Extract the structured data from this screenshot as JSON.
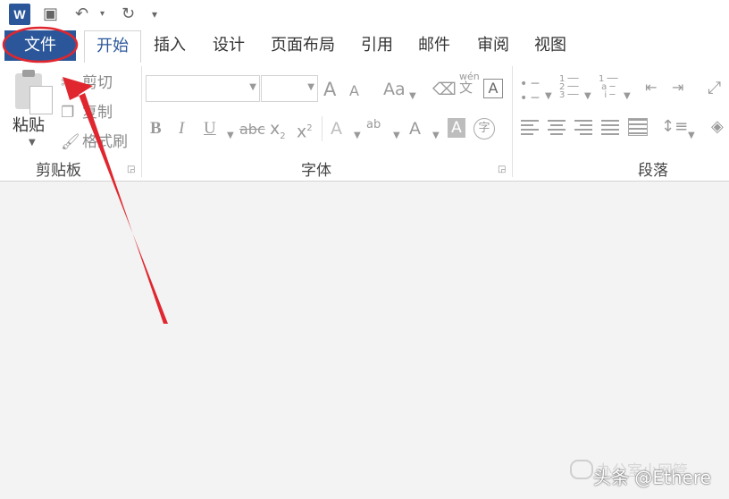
{
  "app": {
    "logo_letter": "W"
  },
  "quick_access": [
    {
      "name": "save-icon",
      "glyph": "💾"
    },
    {
      "name": "undo-icon",
      "glyph": "↶"
    },
    {
      "name": "redo-icon",
      "glyph": "↻"
    },
    {
      "name": "customize-icon",
      "glyph": "▾"
    }
  ],
  "tabs": {
    "file": "文件",
    "items": [
      "开始",
      "插入",
      "设计",
      "页面布局",
      "引用",
      "邮件",
      "审阅",
      "视图"
    ]
  },
  "clipboard": {
    "paste": "粘贴",
    "cut": "剪切",
    "copy": "复制",
    "format_painter": "格式刷",
    "group_label": "剪贴板"
  },
  "font": {
    "group_label": "字体",
    "font_name_value": "",
    "font_size_value": "",
    "grow": "A",
    "shrink": "A",
    "change_case": "Aa",
    "phonetic_top": "wén",
    "phonetic_bottom": "文",
    "char_border": "A",
    "bold": "B",
    "italic": "I",
    "underline": "U",
    "strikethrough": "abc",
    "subscript": "x",
    "sub_mark": "2",
    "superscript": "x",
    "sup_mark": "2",
    "text_effects": "A",
    "highlight": "ab",
    "font_color": "A",
    "char_shading": "A",
    "enclose": "字"
  },
  "paragraph": {
    "group_label": "段落"
  },
  "watermark": {
    "line1": "办公室小网管",
    "line2": "头条 @Ethere"
  },
  "colors": {
    "file_tab": "#2b579a",
    "annotation": "#e0262e"
  }
}
